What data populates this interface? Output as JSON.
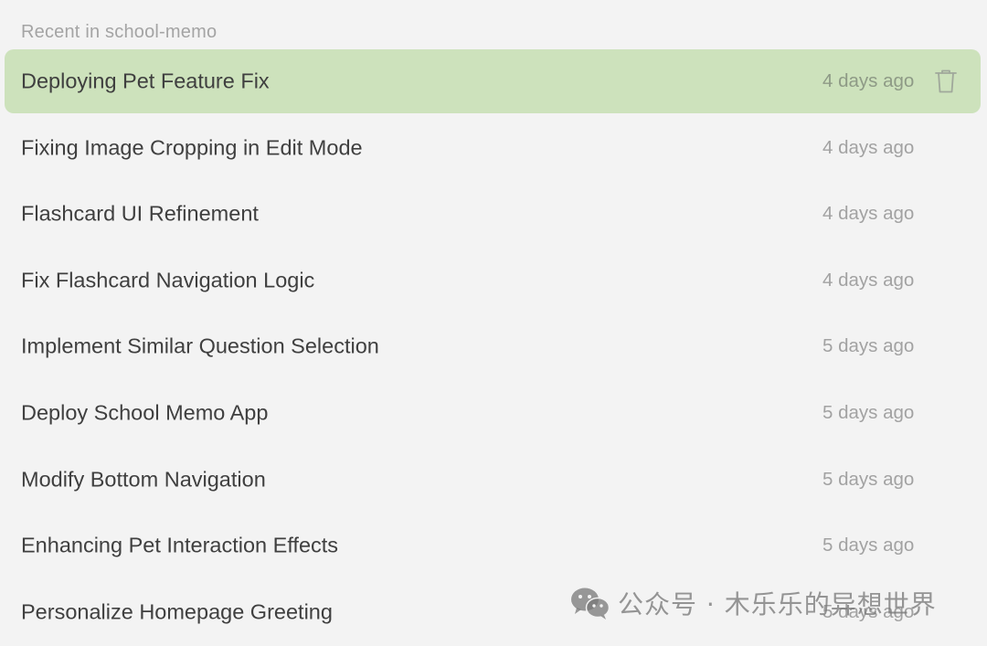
{
  "header": {
    "title": "Recent in school-memo"
  },
  "items": [
    {
      "title": "Deploying Pet Feature Fix",
      "time": "4 days ago",
      "selected": true
    },
    {
      "title": "Fixing Image Cropping in Edit Mode",
      "time": "4 days ago"
    },
    {
      "title": "Flashcard UI Refinement",
      "time": "4 days ago"
    },
    {
      "title": "Fix Flashcard Navigation Logic",
      "time": "4 days ago"
    },
    {
      "title": "Implement Similar Question Selection",
      "time": "5 days ago"
    },
    {
      "title": "Deploy School Memo App",
      "time": "5 days ago"
    },
    {
      "title": "Modify Bottom Navigation",
      "time": "5 days ago"
    },
    {
      "title": "Enhancing Pet Interaction Effects",
      "time": "5 days ago"
    },
    {
      "title": "Personalize Homepage Greeting",
      "time": "5 days ago"
    }
  ],
  "icons": {
    "delete": "trash-icon",
    "watermark": "wechat-icon"
  },
  "watermark": {
    "text": "公众号 · 木乐乐的异想世界"
  },
  "colors": {
    "background": "#f3f3f3",
    "selected_row": "#cde2bc",
    "title_text": "#3f3f3f",
    "time_text": "#a2a2a2",
    "header_text": "#a4a4a4"
  }
}
